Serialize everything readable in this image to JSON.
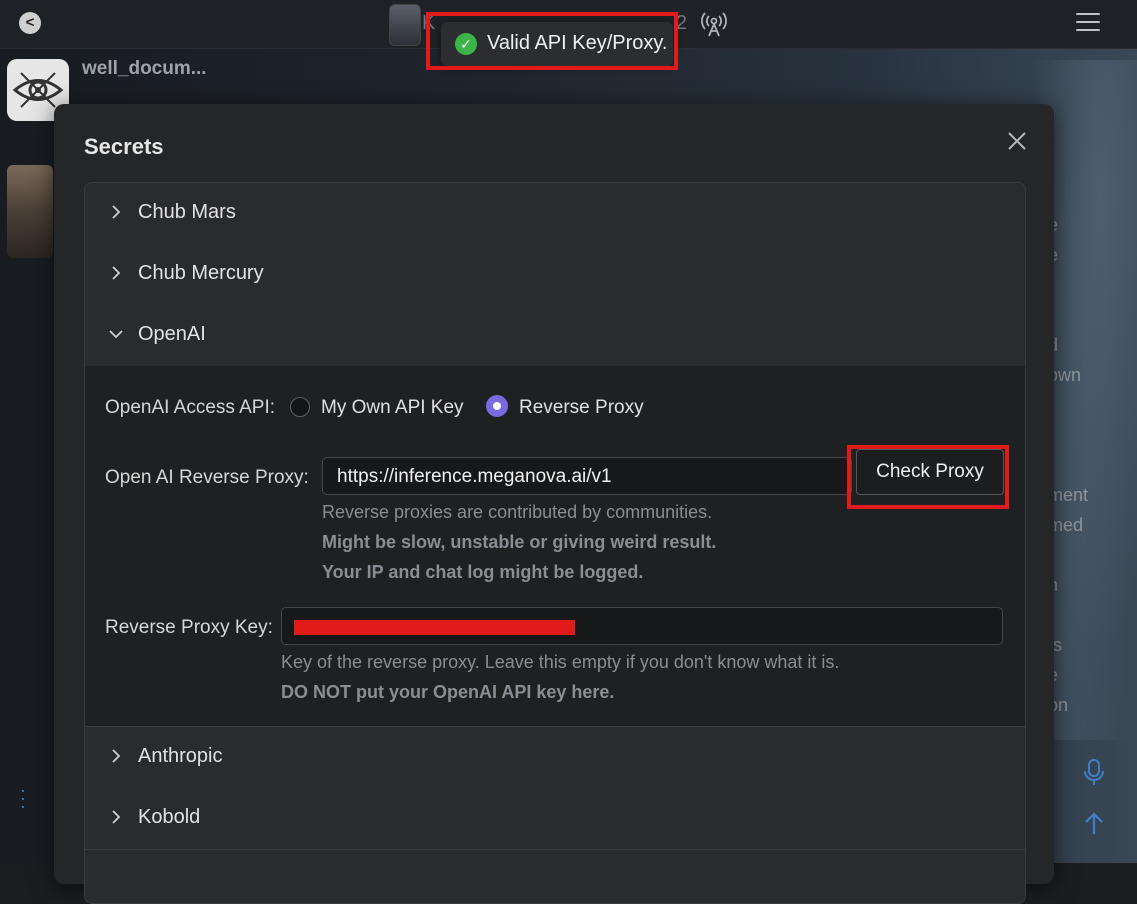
{
  "background": {
    "character_name": "well_docum...",
    "top_faded_text": "K",
    "top_faded_num": "2",
    "right_snippets": "e\ne\n\n\nd\nown\nr\n\n\nment\nmed\n\nn\n\nts\ne\non"
  },
  "toast": {
    "message": "Valid API Key/Proxy."
  },
  "modal": {
    "title": "Secrets",
    "sections": [
      {
        "label": "Chub Mars"
      },
      {
        "label": "Chub Mercury"
      },
      {
        "label": "OpenAI"
      },
      {
        "label": "Anthropic"
      },
      {
        "label": "Kobold"
      }
    ],
    "openai": {
      "access_label": "OpenAI Access API:",
      "option_own": "My Own API Key",
      "option_proxy": "Reverse Proxy",
      "proxy_label": "Open AI Reverse Proxy:",
      "proxy_value": "https://inference.meganova.ai/v1",
      "check_button": "Check Proxy",
      "help1": "Reverse proxies are contributed by communities.",
      "help2": "Might be slow, unstable or giving weird result.",
      "help3": "Your IP and chat log might be logged.",
      "key_label": "Reverse Proxy Key:",
      "key_help1": "Key of the reverse proxy. Leave this empty if you don't know what it is.",
      "key_help2": "DO NOT put your OpenAI API key here."
    }
  },
  "colors": {
    "accent": "#7a6ae0",
    "success": "#3db44a",
    "highlight": "#e11a1a"
  }
}
